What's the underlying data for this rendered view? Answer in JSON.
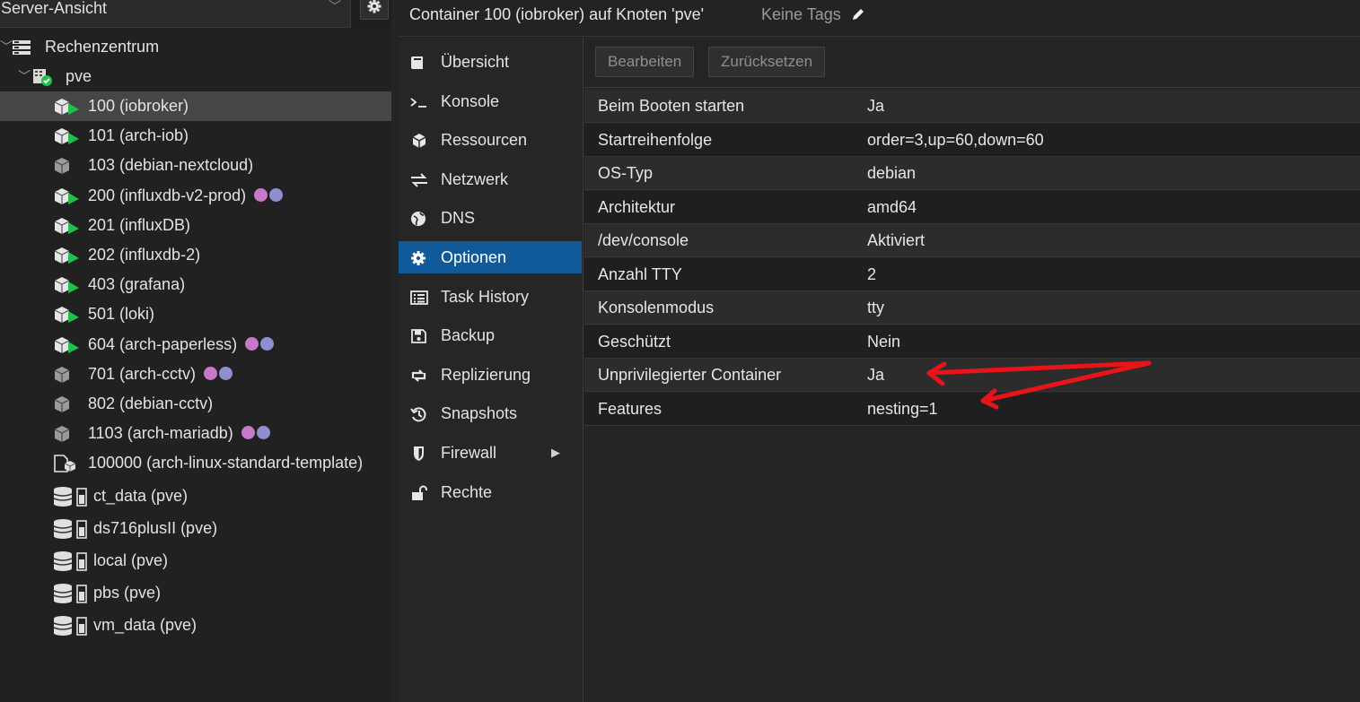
{
  "view_selector": {
    "label": "Server-Ansicht"
  },
  "tree": {
    "datacenter": "Rechenzentrum",
    "node": "pve",
    "items": [
      {
        "label": "100 (iobroker)",
        "kind": "ct-running",
        "tags": []
      },
      {
        "label": "101 (arch-iob)",
        "kind": "ct-running",
        "tags": []
      },
      {
        "label": "103 (debian-nextcloud)",
        "kind": "ct-stopped",
        "tags": []
      },
      {
        "label": "200 (influxdb-v2-prod)",
        "kind": "ct-running",
        "tags": [
          "#c778c8",
          "#8f8fd0"
        ]
      },
      {
        "label": "201 (influxDB)",
        "kind": "ct-running",
        "tags": []
      },
      {
        "label": "202 (influxdb-2)",
        "kind": "ct-running",
        "tags": []
      },
      {
        "label": "403 (grafana)",
        "kind": "ct-running",
        "tags": []
      },
      {
        "label": "501 (loki)",
        "kind": "ct-running",
        "tags": []
      },
      {
        "label": "604 (arch-paperless)",
        "kind": "ct-running",
        "tags": [
          "#c778c8",
          "#8f8fd0"
        ]
      },
      {
        "label": "701 (arch-cctv)",
        "kind": "ct-stopped",
        "tags": [
          "#c778c8",
          "#8f8fd0"
        ]
      },
      {
        "label": "802 (debian-cctv)",
        "kind": "ct-stopped",
        "tags": []
      },
      {
        "label": "1103 (arch-mariadb)",
        "kind": "ct-stopped",
        "tags": [
          "#c778c8",
          "#8f8fd0"
        ]
      },
      {
        "label": "100000 (arch-linux-standard-template)",
        "kind": "template",
        "tags": []
      },
      {
        "label": "ct_data (pve)",
        "kind": "storage",
        "tags": []
      },
      {
        "label": "ds716plusII (pve)",
        "kind": "storage",
        "tags": []
      },
      {
        "label": "local (pve)",
        "kind": "storage",
        "tags": []
      },
      {
        "label": "pbs (pve)",
        "kind": "storage",
        "tags": []
      },
      {
        "label": "vm_data (pve)",
        "kind": "storage",
        "tags": []
      }
    ]
  },
  "header": {
    "title": "Container 100 (iobroker) auf Knoten 'pve'",
    "tags_label": "Keine Tags"
  },
  "nav": {
    "items": [
      {
        "label": "Übersicht",
        "icon": "book-icon"
      },
      {
        "label": "Konsole",
        "icon": "terminal-icon"
      },
      {
        "label": "Ressourcen",
        "icon": "cube-icon"
      },
      {
        "label": "Netzwerk",
        "icon": "exchange-icon"
      },
      {
        "label": "DNS",
        "icon": "globe-icon"
      },
      {
        "label": "Optionen",
        "icon": "gear-icon",
        "active": true
      },
      {
        "label": "Task History",
        "icon": "list-icon"
      },
      {
        "label": "Backup",
        "icon": "floppy-icon"
      },
      {
        "label": "Replizierung",
        "icon": "retweet-icon"
      },
      {
        "label": "Snapshots",
        "icon": "history-icon"
      },
      {
        "label": "Firewall",
        "icon": "shield-icon",
        "has_submenu": true
      },
      {
        "label": "Rechte",
        "icon": "unlock-icon"
      }
    ]
  },
  "toolbar": {
    "edit_label": "Bearbeiten",
    "reset_label": "Zurücksetzen"
  },
  "options": {
    "rows": [
      {
        "key": "Beim Booten starten",
        "value": "Ja"
      },
      {
        "key": "Startreihenfolge",
        "value": "order=3,up=60,down=60"
      },
      {
        "key": "OS-Typ",
        "value": "debian"
      },
      {
        "key": "Architektur",
        "value": "amd64"
      },
      {
        "key": "/dev/console",
        "value": "Aktiviert"
      },
      {
        "key": "Anzahl TTY",
        "value": "2"
      },
      {
        "key": "Konsolenmodus",
        "value": "tty"
      },
      {
        "key": "Geschützt",
        "value": "Nein"
      },
      {
        "key": "Unprivilegierter Container",
        "value": "Ja"
      },
      {
        "key": "Features",
        "value": "nesting=1"
      }
    ]
  },
  "colors": {
    "accent": "#115a99",
    "running": "#21bf4b",
    "annotation": "#e8141a"
  }
}
